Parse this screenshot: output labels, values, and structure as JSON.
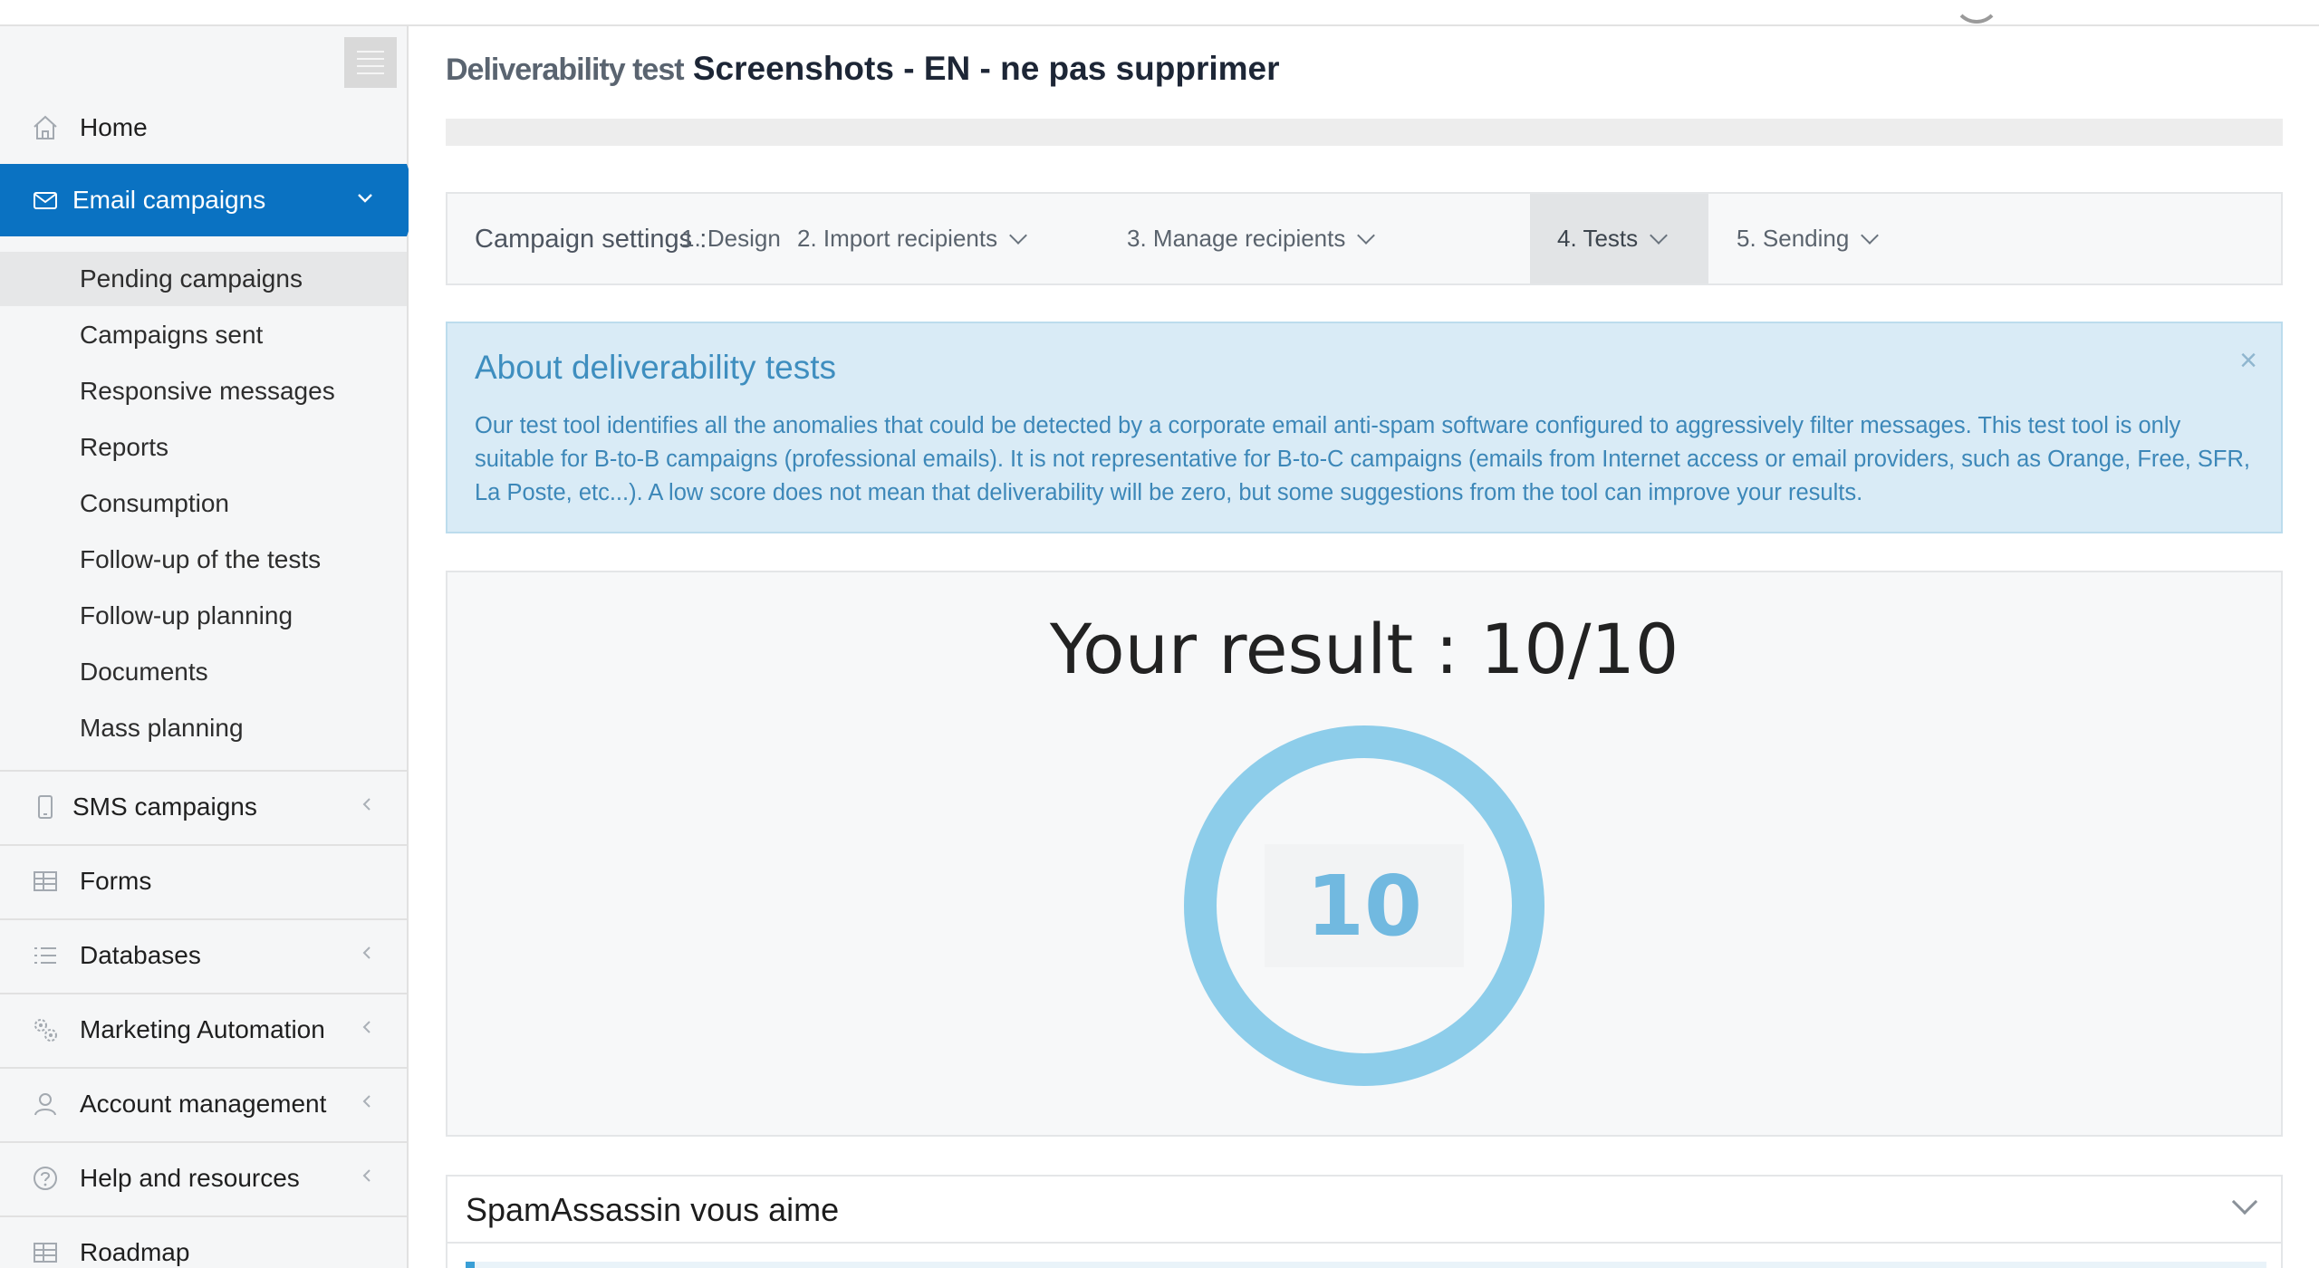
{
  "page": {
    "title_prefix": "Deliverability test",
    "title_name": "Screenshots - EN - ne pas supprimer"
  },
  "sidebar": {
    "items": [
      {
        "label": "Home",
        "icon": "home-icon"
      },
      {
        "label": "Email campaigns",
        "icon": "envelope-icon"
      },
      {
        "label": "SMS campaigns",
        "icon": "mobile-icon"
      },
      {
        "label": "Forms",
        "icon": "table-icon"
      },
      {
        "label": "Databases",
        "icon": "list-icon"
      },
      {
        "label": "Marketing Automation",
        "icon": "gears-icon"
      },
      {
        "label": "Account management",
        "icon": "user-icon"
      },
      {
        "label": "Help and resources",
        "icon": "question-icon"
      },
      {
        "label": "Roadmap",
        "icon": "table-icon"
      }
    ],
    "email_sub": [
      "Pending campaigns",
      "Campaigns sent",
      "Responsive messages",
      "Reports",
      "Consumption",
      "Follow-up of the tests",
      "Follow-up planning",
      "Documents",
      "Mass planning"
    ]
  },
  "steps": {
    "label": "Campaign settings :",
    "items": [
      "1. Design",
      "2. Import recipients",
      "3. Manage recipients",
      "4. Tests",
      "5. Sending"
    ],
    "active": "4. Tests"
  },
  "alert": {
    "title": "About deliverability tests",
    "body": "Our test tool identifies all the anomalies that could be detected by a corporate email anti-spam software configured to aggressively filter messages. This test tool is only suitable for B-to-B campaigns (professional emails). It is not representative for B-to-C campaigns (emails from Internet access or email providers, such as Orange, Free, SFR, La Poste, etc...). A low score does not mean that deliverability will be zero, but some suggestions from the tool can improve your results.",
    "close": "×"
  },
  "result": {
    "title": "Your result : 10/10",
    "score": "10",
    "score_fraction": 1.0,
    "ring_color": "#8dcdea"
  },
  "accordion": {
    "title": "SpamAssassin vous aime"
  },
  "colors": {
    "accent": "#0a72c2",
    "alert_bg": "#d9ebf6",
    "alert_text": "#3c87b8"
  }
}
